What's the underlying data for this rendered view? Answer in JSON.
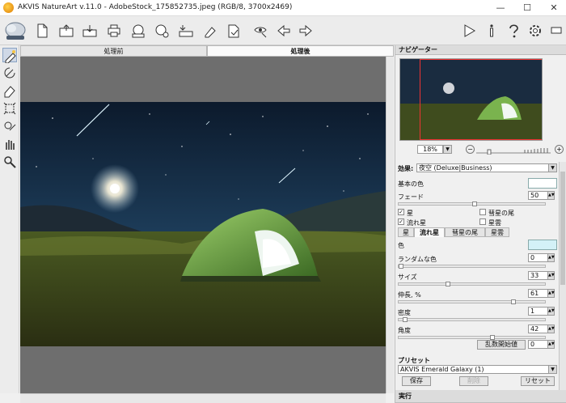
{
  "window": {
    "title": "AKVIS NatureArt v.11.0 - AdobeStock_175852735.jpeg (RGB/8, 3700x2469)",
    "minimize": "—",
    "maximize": "☐",
    "close": "✕"
  },
  "toolbar": {
    "icons": [
      "new-file-icon",
      "open-file-icon",
      "save-icon",
      "print-icon",
      "export-icon",
      "share-icon",
      "batch-icon",
      "upload-icon",
      "settings-file-icon",
      "eyedropper-icon",
      "back-arrow-icon",
      "forward-arrow-icon",
      "run-icon",
      "info-icon",
      "help-icon",
      "gear-icon",
      "flag-icon"
    ]
  },
  "view_tabs": {
    "before": "処理前",
    "after": "処理後"
  },
  "navigator": {
    "title": "ナビゲーター",
    "zoom": "18%"
  },
  "settings": {
    "effect_label": "効果:",
    "effect_value": "夜空 (Deluxe|Business)",
    "base_color_label": "基本の色",
    "base_color": "#ffffff",
    "fade_label": "フェード",
    "fade_value": "50",
    "checks": {
      "stars": {
        "label": "星",
        "checked": true
      },
      "comet_tail": {
        "label": "彗星の尾",
        "checked": false
      },
      "shooting_star": {
        "label": "流れ星",
        "checked": true
      },
      "nebula": {
        "label": "星雲",
        "checked": false
      }
    },
    "subtabs": [
      "星",
      "流れ星",
      "彗星の尾",
      "星雲"
    ],
    "active_subtab": "流れ星",
    "color_label": "色",
    "color_value": "#d3f1f7",
    "random_color_label": "ランダムな色",
    "random_color_value": "0",
    "size_label": "サイズ",
    "size_value": "33",
    "stretch_label": "伸長, %",
    "stretch_value": "61",
    "density_label": "密度",
    "density_value": "1",
    "angle_label": "角度",
    "angle_value": "42",
    "random_seed_button": "乱数開始値",
    "random_seed_value": "0"
  },
  "presets": {
    "title": "プリセット",
    "selected": "AKVIS Emerald Galaxy (1)",
    "save": "保存",
    "delete": "削除",
    "reset": "リセット"
  },
  "run_panel": {
    "title": "実行"
  }
}
